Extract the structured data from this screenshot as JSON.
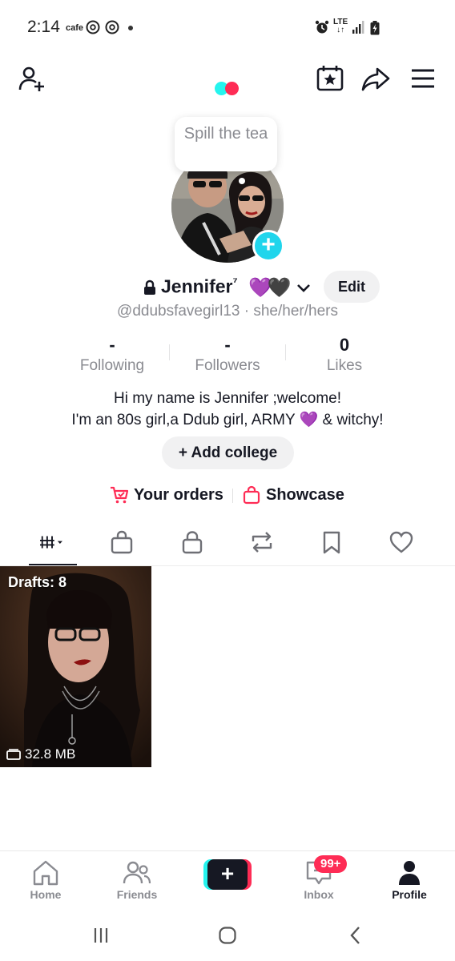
{
  "status_bar": {
    "time": "2:14",
    "app_label": "cafe",
    "network": "LTE",
    "icons": [
      "threads-icon",
      "threads-icon",
      "notification-dot",
      "alarm-icon",
      "lte-icon",
      "signal-icon",
      "battery-icon"
    ]
  },
  "top_nav": {
    "icons": [
      "add-friend-icon",
      "tiktok-logo",
      "calendar-star-icon",
      "share-icon",
      "menu-icon"
    ]
  },
  "note": {
    "text": "Spill the tea"
  },
  "profile": {
    "name": "Jennifer",
    "name_suffix": "⁷",
    "name_emoji": "💜🖤",
    "edit_label": "Edit",
    "handle": "@ddubsfavegirl13 · she/her/hers",
    "stats": [
      {
        "value": "-",
        "label": "Following"
      },
      {
        "value": "-",
        "label": "Followers"
      },
      {
        "value": "0",
        "label": "Likes"
      }
    ],
    "bio_line1": "Hi my name is Jennifer ;welcome!",
    "bio_line2": "I'm an 80s girl,a Ddub girl, ARMY 💜 & witchy!",
    "add_college_label": "+ Add college",
    "links": [
      {
        "label": "Your orders",
        "icon": "cart-icon"
      },
      {
        "label": "Showcase",
        "icon": "shopping-bag-icon"
      }
    ]
  },
  "tabs": [
    "videos-grid-icon",
    "shop-bag-icon",
    "private-lock-icon",
    "repost-icon",
    "favorites-bookmark-icon",
    "liked-heart-icon"
  ],
  "grid": {
    "draft_label": "Drafts: 8",
    "draft_size": "32.8 MB"
  },
  "bottom_nav": {
    "items": [
      {
        "label": "Home",
        "icon": "home-icon"
      },
      {
        "label": "Friends",
        "icon": "friends-icon"
      },
      {
        "label": "",
        "icon": "create-plus-icon"
      },
      {
        "label": "Inbox",
        "icon": "inbox-icon"
      },
      {
        "label": "Profile",
        "icon": "profile-icon"
      }
    ],
    "inbox_badge": "99+"
  },
  "colors": {
    "accent_cyan": "#25f4ee",
    "accent_red": "#fe2c55",
    "avatar_plus": "#20d5ec",
    "text_primary": "#161823",
    "text_secondary": "#8a8b91"
  }
}
